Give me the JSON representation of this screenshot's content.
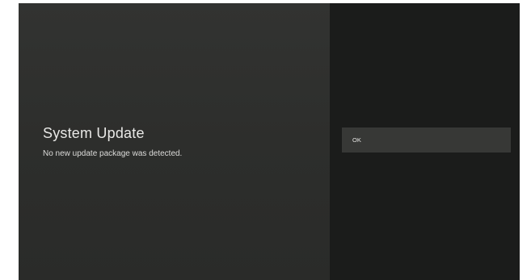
{
  "dialog": {
    "title": "System Update",
    "message": "No new update package was detected."
  },
  "actions": {
    "ok_label": "OK"
  },
  "colors": {
    "left_pane_bg": "#2e2f2d",
    "right_pane_bg": "#1b1c1b",
    "button_bg": "#373836",
    "text": "#e8e8e6"
  }
}
